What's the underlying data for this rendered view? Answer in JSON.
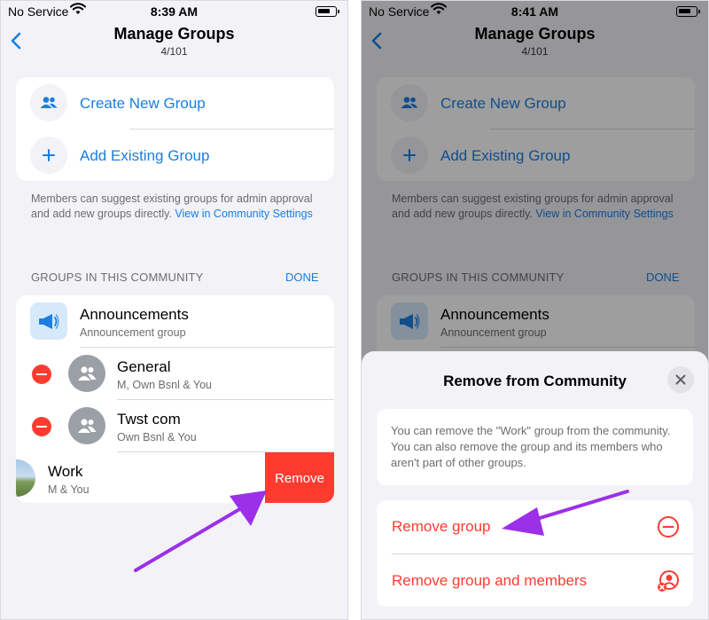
{
  "left": {
    "status": {
      "carrier": "No Service",
      "time": "8:39 AM"
    },
    "nav": {
      "title": "Manage Groups",
      "subtitle": "4/101"
    },
    "actions": [
      {
        "label": "Create New Group",
        "icon": "people-icon"
      },
      {
        "label": "Add Existing Group",
        "icon": "plus-icon"
      }
    ],
    "note": {
      "text": "Members can suggest existing groups for admin approval and add new groups directly. ",
      "link": "View in Community Settings"
    },
    "section": {
      "header": "GROUPS IN THIS COMMUNITY",
      "done": "DONE"
    },
    "groups": [
      {
        "name": "Announcements",
        "subtitle": "Announcement group"
      },
      {
        "name": "General",
        "subtitle": "M, Own Bsnl & You"
      },
      {
        "name": "Twst com",
        "subtitle": "Own Bsnl & You"
      },
      {
        "name": "Work",
        "subtitle": "M & You"
      }
    ],
    "swipe_action": "Remove"
  },
  "right": {
    "status": {
      "carrier": "No Service",
      "time": "8:41 AM"
    },
    "nav": {
      "title": "Manage Groups",
      "subtitle": "4/101"
    },
    "actions": [
      {
        "label": "Create New Group"
      },
      {
        "label": "Add Existing Group"
      }
    ],
    "note": {
      "text": "Members can suggest existing groups for admin approval and add new groups directly. ",
      "link": "View in Community Settings"
    },
    "section": {
      "header": "GROUPS IN THIS COMMUNITY",
      "done": "DONE"
    },
    "groups": [
      {
        "name": "Announcements",
        "subtitle": "Announcement group"
      }
    ],
    "sheet": {
      "title": "Remove from Community",
      "info": "You can remove the \"Work\" group from the community. You can also remove the group and its members who aren't part of other groups.",
      "options": [
        {
          "label": "Remove group",
          "icon": "minus-circle-icon"
        },
        {
          "label": "Remove group and members",
          "icon": "remove-member-icon"
        }
      ]
    }
  },
  "colors": {
    "accent": "#1a7ee3",
    "destructive": "#ff3b30",
    "annotation_arrow": "#9b30e8"
  }
}
